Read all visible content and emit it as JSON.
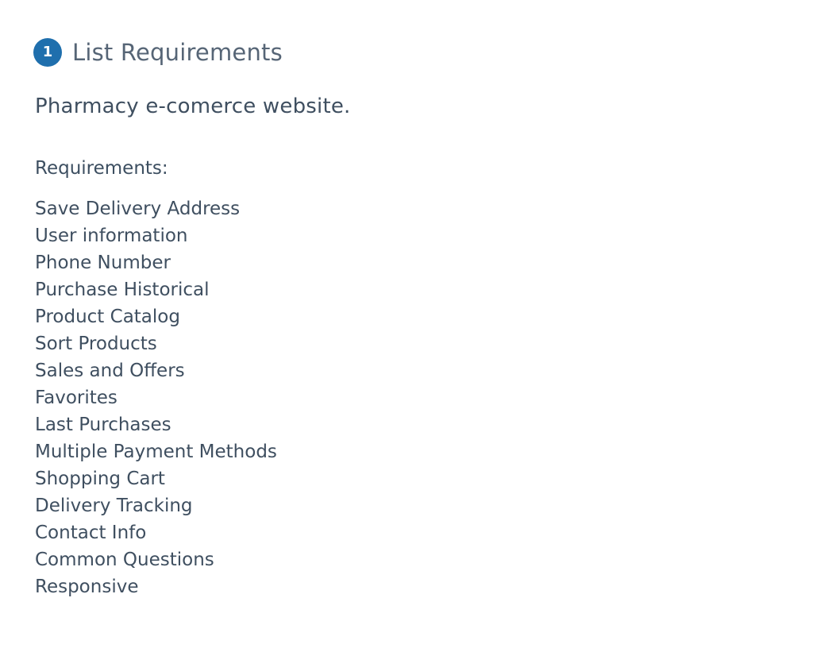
{
  "step": {
    "number": "1",
    "title": "List Requirements"
  },
  "description": "Pharmacy e-comerce website.",
  "requirements": {
    "heading": "Requirements:",
    "items": [
      "Save Delivery Address",
      "User information",
      "Phone Number",
      "Purchase Historical",
      "Product Catalog",
      "Sort Products",
      "Sales and Offers",
      "Favorites",
      "Last Purchases",
      "Multiple Payment Methods",
      "Shopping Cart",
      "Delivery Tracking",
      "Contact Info",
      "Common Questions",
      "Responsive"
    ]
  },
  "colors": {
    "badge": "#1f6fad",
    "text": "#3f4f60"
  }
}
